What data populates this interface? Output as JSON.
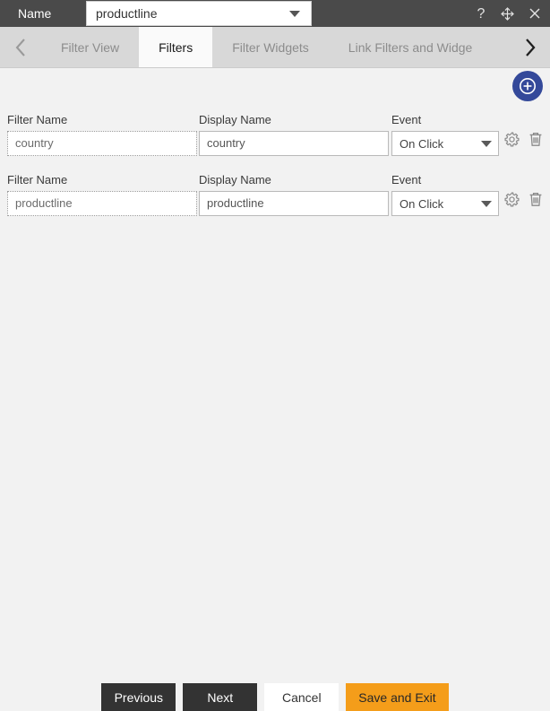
{
  "titlebar": {
    "label": "Name",
    "name_value": "productline",
    "name_caret_icon": "chevron-down-icon",
    "help_icon": "question-mark-icon",
    "move_icon": "move-icon",
    "close_icon": "close-icon"
  },
  "tabs": {
    "prev_icon": "chevron-left-icon",
    "next_icon": "chevron-right-icon",
    "items": [
      {
        "label": "Filter View",
        "active": false
      },
      {
        "label": "Filters",
        "active": true
      },
      {
        "label": "Filter Widgets",
        "active": false
      },
      {
        "label": "Link Filters and Widge",
        "active": false
      }
    ]
  },
  "toolbar": {
    "add_label": "+",
    "add_icon": "plus-circle-icon",
    "add_color": "#34499a"
  },
  "labels": {
    "filter_name": "Filter Name",
    "display_name": "Display Name",
    "event": "Event"
  },
  "rows": [
    {
      "filter_name": "country",
      "display_name": "country",
      "event": "On Click",
      "settings_icon": "gear-icon",
      "delete_icon": "trash-icon"
    },
    {
      "filter_name": "productline",
      "display_name": "productline",
      "event": "On Click",
      "settings_icon": "gear-icon",
      "delete_icon": "trash-icon"
    }
  ],
  "event_options": [
    "On Click"
  ],
  "footer": {
    "previous": "Previous",
    "next": "Next",
    "cancel": "Cancel",
    "save_and_exit": "Save and Exit",
    "accent_color": "#f49d1a"
  }
}
